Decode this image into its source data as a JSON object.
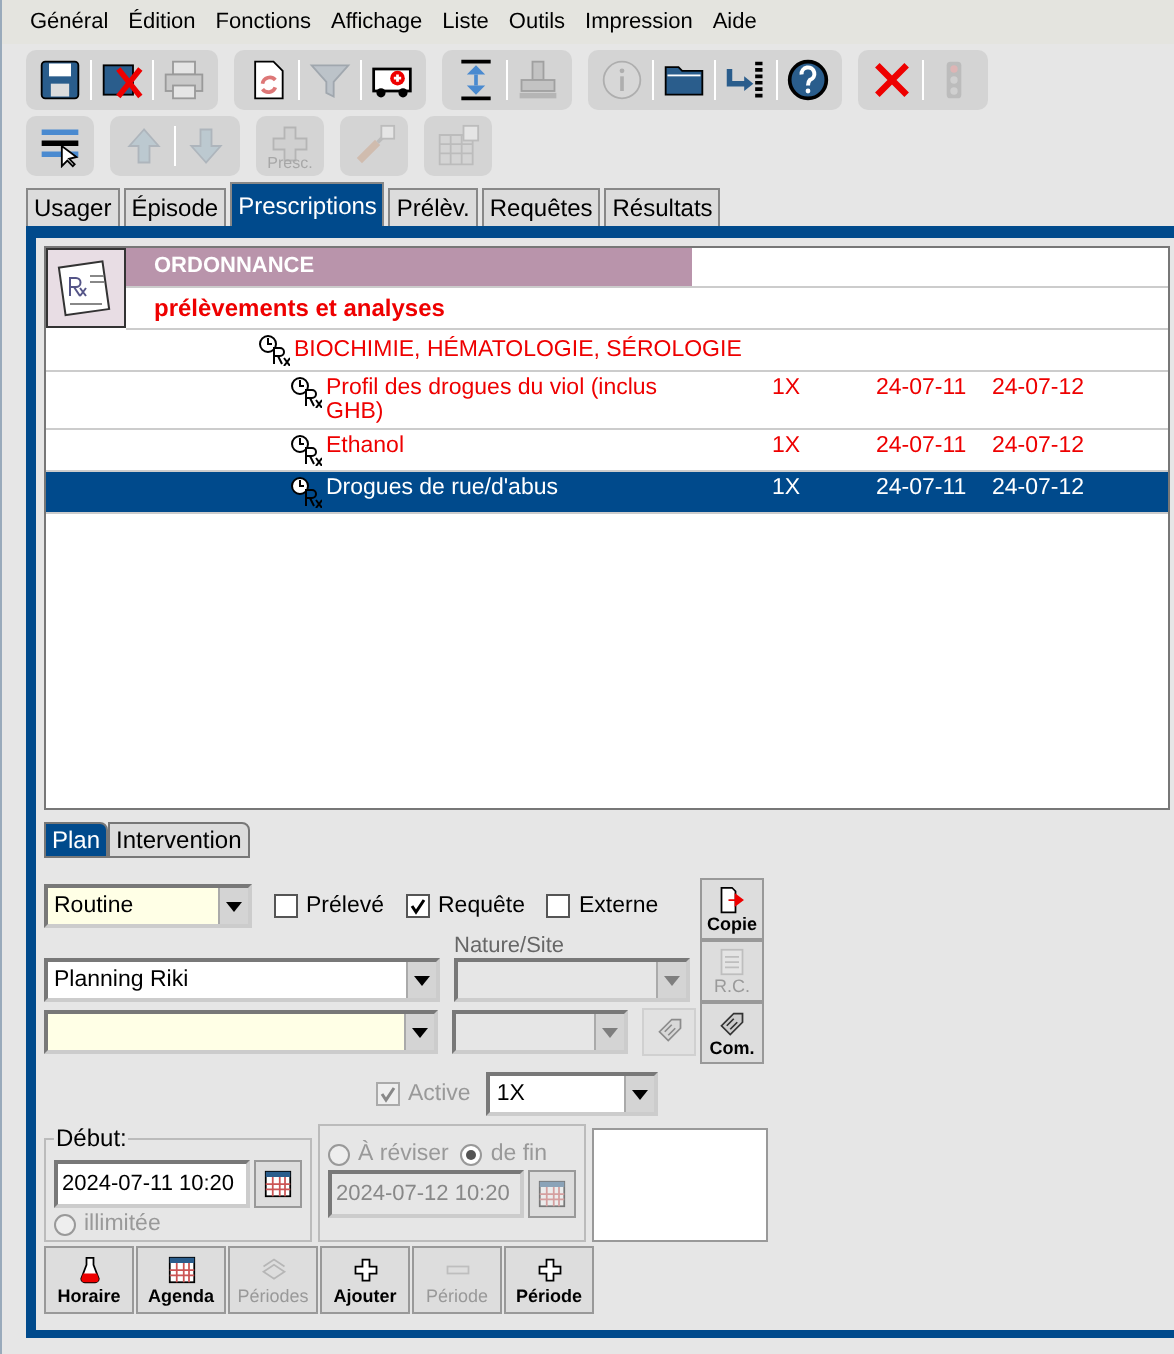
{
  "menu": [
    "Général",
    "Édition",
    "Fonctions",
    "Affichage",
    "Liste",
    "Outils",
    "Impression",
    "Aide"
  ],
  "toolbar_rows": [
    [
      {
        "buttons": [
          {
            "kind": "save",
            "disabled": false
          },
          {
            "kind": "cancel_save",
            "disabled": false
          },
          {
            "kind": "print",
            "disabled": true
          }
        ]
      },
      {
        "buttons": [
          {
            "kind": "refresh_doc",
            "disabled": false
          },
          {
            "kind": "filter",
            "disabled": true
          },
          {
            "kind": "ambulance",
            "disabled": false
          }
        ]
      },
      {
        "buttons": [
          {
            "kind": "expand",
            "disabled": false
          },
          {
            "kind": "stamp",
            "disabled": true
          }
        ]
      },
      {
        "buttons": [
          {
            "kind": "info",
            "disabled": true
          },
          {
            "kind": "folder",
            "disabled": false
          },
          {
            "kind": "steps",
            "disabled": false
          },
          {
            "kind": "help",
            "disabled": false
          }
        ]
      },
      {
        "buttons": [
          {
            "kind": "close",
            "disabled": false
          },
          {
            "kind": "traffic",
            "disabled": true
          }
        ]
      }
    ],
    [
      {
        "buttons": [
          {
            "kind": "list_select",
            "disabled": false
          }
        ]
      },
      {
        "buttons": [
          {
            "kind": "up",
            "disabled": true
          },
          {
            "kind": "down",
            "disabled": true
          }
        ]
      },
      {
        "buttons": [
          {
            "kind": "plus",
            "disabled": true,
            "label": "Presc."
          }
        ]
      },
      {
        "buttons": [
          {
            "kind": "syringe",
            "disabled": true
          }
        ]
      },
      {
        "buttons": [
          {
            "kind": "grid",
            "disabled": true
          }
        ]
      }
    ]
  ],
  "tabs": [
    {
      "label": "Usager",
      "selected": false
    },
    {
      "label": "Épisode",
      "selected": false
    },
    {
      "label": "Prescriptions",
      "selected": true
    },
    {
      "label": "Prélèv.",
      "selected": false
    },
    {
      "label": "Requêtes",
      "selected": false
    },
    {
      "label": "Résultats",
      "selected": false
    }
  ],
  "prescription": {
    "title": "ORDONNANCE",
    "subtitle": "prélèvements et analyses",
    "group": "BIOCHIMIE, HÉMATOLOGIE, SÉROLOGIE",
    "rows": [
      {
        "name": "Profil des drogues du viol (inclus GHB)",
        "frequency": "1X",
        "start": "24-07-11",
        "end": "24-07-12",
        "selected": false
      },
      {
        "name": "Ethanol",
        "frequency": "1X",
        "start": "24-07-11",
        "end": "24-07-12",
        "selected": false
      },
      {
        "name": "Drogues de rue/d'abus",
        "frequency": "1X",
        "start": "24-07-11",
        "end": "24-07-12",
        "selected": true
      }
    ]
  },
  "subtabs": [
    {
      "label": "Plan",
      "selected": true
    },
    {
      "label": "Intervention",
      "selected": false
    }
  ],
  "form": {
    "priority": "Routine",
    "checkboxes": [
      {
        "label": "Prélevé",
        "checked": false
      },
      {
        "label": "Requête",
        "checked": true
      },
      {
        "label": "Externe",
        "checked": false
      }
    ],
    "planning": "Planning Riki",
    "nature_label": "Nature/Site",
    "side_buttons": [
      {
        "kind": "copy",
        "label": "Copie",
        "disabled": false
      },
      {
        "kind": "list",
        "label": "R.C.",
        "disabled": true
      },
      {
        "kind": "tag",
        "label": "Com.",
        "disabled": false
      }
    ],
    "active": {
      "label": "Active",
      "checked": true,
      "disabled": true
    },
    "frequency": "1X",
    "start_label": "Début:",
    "start_value": "2024-07-11 10:20",
    "unlimited": {
      "label": "illimitée",
      "selected": false,
      "disabled": true
    },
    "end_options": [
      {
        "label": "À réviser",
        "selected": false,
        "disabled": true
      },
      {
        "label": "de fin",
        "selected": true,
        "disabled": true
      }
    ],
    "end_value": "2024-07-12 10:20",
    "buttons": [
      {
        "kind": "flask",
        "label": "Horaire",
        "disabled": false
      },
      {
        "kind": "calendar",
        "label": "Agenda",
        "disabled": false
      },
      {
        "kind": "stack",
        "label": "Périodes",
        "disabled": true
      },
      {
        "kind": "plus",
        "label": "Ajouter",
        "disabled": false
      },
      {
        "kind": "minus",
        "label": "Période",
        "disabled": true
      },
      {
        "kind": "plus",
        "label": "Période",
        "disabled": false
      }
    ]
  }
}
